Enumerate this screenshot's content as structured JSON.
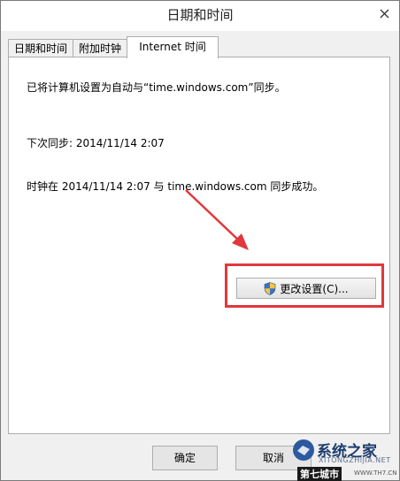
{
  "window": {
    "title": "日期和时间",
    "close_icon": "close-icon"
  },
  "tabs": [
    {
      "label": "日期和时间",
      "active": false
    },
    {
      "label": "附加时钟",
      "active": false
    },
    {
      "label": "Internet 时间",
      "active": true
    }
  ],
  "panel": {
    "sync_status": "已将计算机设置为自动与“time.windows.com”同步。",
    "next_sync": "下次同步: 2014/11/14 2:07",
    "last_sync_result": "时钟在 2014/11/14 2:07 与 time.windows.com 同步成功。",
    "change_settings_label": "更改设置(C)...",
    "change_settings_icon": "uac-shield-icon"
  },
  "footer": {
    "ok_label": "确定",
    "cancel_label": "取消"
  },
  "annotation": {
    "highlight_color": "#e0383d"
  },
  "watermark": {
    "main": "系统之家",
    "sub": "XITONGZHIJIA.NET",
    "bottom": "第七城市",
    "url": "WWW.TH7.CN"
  }
}
